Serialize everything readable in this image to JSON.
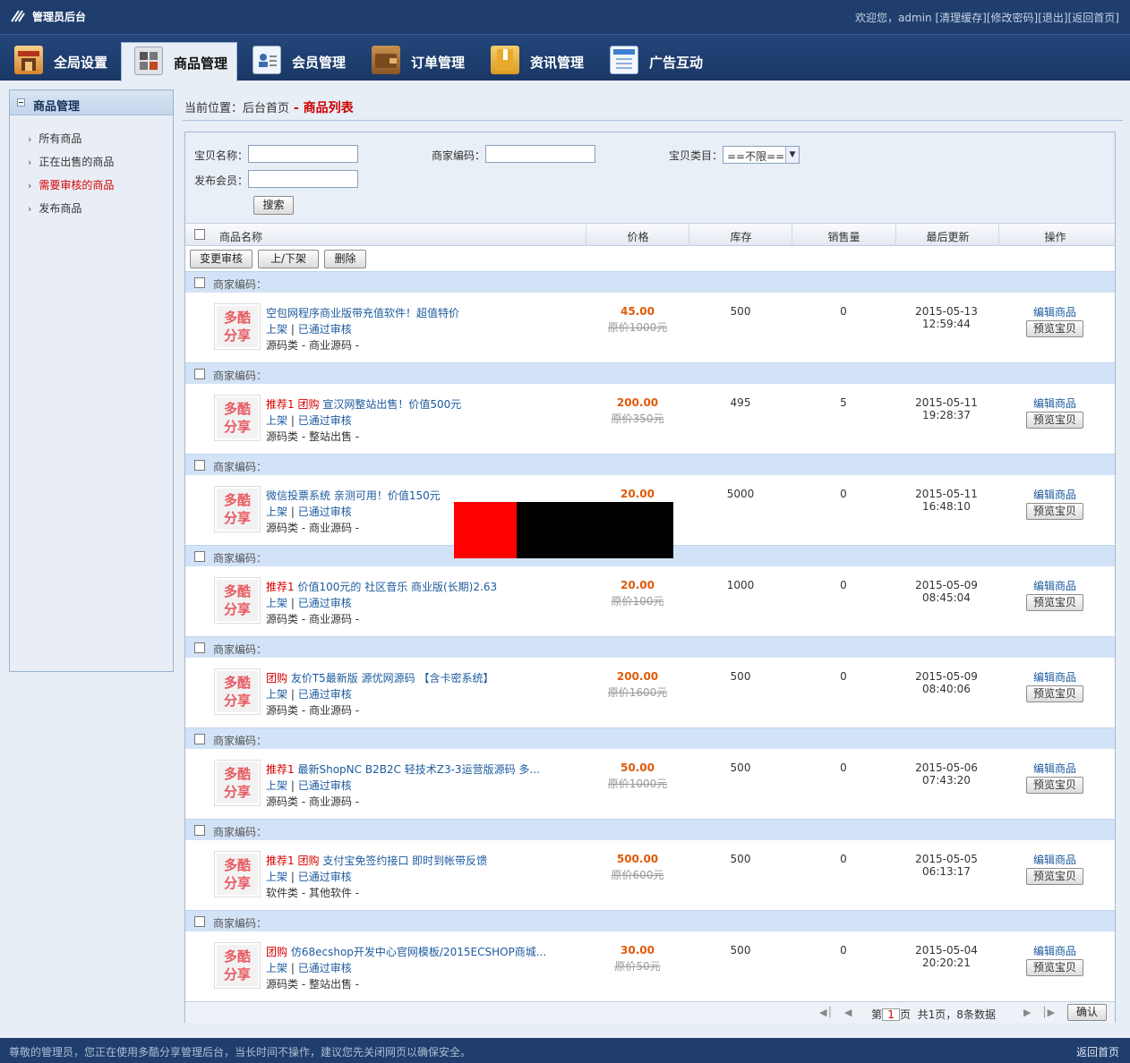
{
  "header": {
    "brand": "管理员后台",
    "welcome_prefix": "欢迎您，",
    "username": "admin",
    "links": [
      "[清理缓存]",
      "[修改密码]",
      "[退出]",
      "[返回首页]"
    ]
  },
  "nav": {
    "tabs": [
      {
        "label": "全局设置",
        "icon": "settings-icon"
      },
      {
        "label": "商品管理",
        "icon": "goods-icon",
        "active": true
      },
      {
        "label": "会员管理",
        "icon": "member-icon"
      },
      {
        "label": "订单管理",
        "icon": "order-icon"
      },
      {
        "label": "资讯管理",
        "icon": "news-icon"
      },
      {
        "label": "广告互动",
        "icon": "ad-icon"
      }
    ]
  },
  "sidebar": {
    "title": "商品管理",
    "items": [
      {
        "label": "所有商品"
      },
      {
        "label": "正在出售的商品"
      },
      {
        "label": "需要审核的商品",
        "active": true
      },
      {
        "label": "发布商品"
      }
    ]
  },
  "breadcrumb": {
    "prefix": "当前位置：",
    "home": "后台首页",
    "sep": " - ",
    "current": "商品列表"
  },
  "search": {
    "name_label": "宝贝名称：",
    "code_label": "商家编码：",
    "category_label": "宝贝类目：",
    "category_value": "==不限==",
    "member_label": "发布会员：",
    "button": "搜索"
  },
  "table": {
    "headers": [
      "商品名称",
      "价格",
      "库存",
      "销售量",
      "最后更新",
      "操作"
    ],
    "actions": [
      "变更审核",
      "上/下架",
      "删除"
    ],
    "row_head_label": "商家编码：",
    "thumb_text": [
      "多酷",
      "分享"
    ],
    "status_up": "上架",
    "status_sep": "|",
    "status_approved": "已通过审核",
    "edit_label": "编辑商品",
    "preview_label": "预览宝贝",
    "rows": [
      {
        "tags": [],
        "name": "空包网程序商业版带充值软件！超值特价",
        "category": "源码类 - 商业源码 -",
        "price": "45.00",
        "orig": "原价1000元",
        "stock": "500",
        "sold": "0",
        "date": "2015-05-13",
        "time": "12:59:44"
      },
      {
        "tags": [
          "推荐1",
          "团购"
        ],
        "name": "宣汉网整站出售！价值500元",
        "category": "源码类 - 整站出售 -",
        "price": "200.00",
        "orig": "原价350元",
        "stock": "495",
        "sold": "5",
        "date": "2015-05-11",
        "time": "19:28:37"
      },
      {
        "tags": [],
        "name": "微信投票系统 亲测可用！价值150元",
        "category": "源码类 - 商业源码 -",
        "price": "20.00",
        "orig": "",
        "stock": "5000",
        "sold": "0",
        "date": "2015-05-11",
        "time": "16:48:10"
      },
      {
        "tags": [
          "推荐1"
        ],
        "name": "价值100元的 社区音乐 商业版(长期)2.63",
        "category": "源码类 - 商业源码 -",
        "price": "20.00",
        "orig": "原价100元",
        "stock": "1000",
        "sold": "0",
        "date": "2015-05-09",
        "time": "08:45:04"
      },
      {
        "tags": [
          "团购"
        ],
        "name": "友价T5最新版 源优网源码 【含卡密系统】",
        "category": "源码类 - 商业源码 -",
        "price": "200.00",
        "orig": "原价1600元",
        "stock": "500",
        "sold": "0",
        "date": "2015-05-09",
        "time": "08:40:06"
      },
      {
        "tags": [
          "推荐1"
        ],
        "name": "最新ShopNC B2B2C 轻技术Z3-3运营版源码 多...",
        "category": "源码类 - 商业源码 -",
        "price": "50.00",
        "orig": "原价1000元",
        "stock": "500",
        "sold": "0",
        "date": "2015-05-06",
        "time": "07:43:20"
      },
      {
        "tags": [
          "推荐1",
          "团购"
        ],
        "name": "支付宝免签约接口 即时到帐带反馈",
        "category": "软件类 - 其他软件 -",
        "price": "500.00",
        "orig": "原价600元",
        "stock": "500",
        "sold": "0",
        "date": "2015-05-05",
        "time": "06:13:17"
      },
      {
        "tags": [
          "团购"
        ],
        "name": "仿68ecshop开发中心官网模板/2015ECSHOP商城...",
        "category": "源码类 - 整站出售 -",
        "price": "30.00",
        "orig": "原价50元",
        "stock": "500",
        "sold": "0",
        "date": "2015-05-04",
        "time": "20:20:21"
      }
    ]
  },
  "pager": {
    "page_prefix": "第",
    "page": "1",
    "page_suffix": "页",
    "summary": "共1页，8条数据",
    "confirm": "确认"
  },
  "footer": {
    "notice": "尊敬的管理员，您正在使用多酷分享管理后台，当长时间不操作，建议您先关闭网页以确保安全。",
    "home_link": "返回首页"
  },
  "colors": {
    "header_bg": "#1f3e6e",
    "link_blue": "#1b5a9e",
    "tag_red": "#d40000",
    "price_orange": "#e05a0a"
  }
}
